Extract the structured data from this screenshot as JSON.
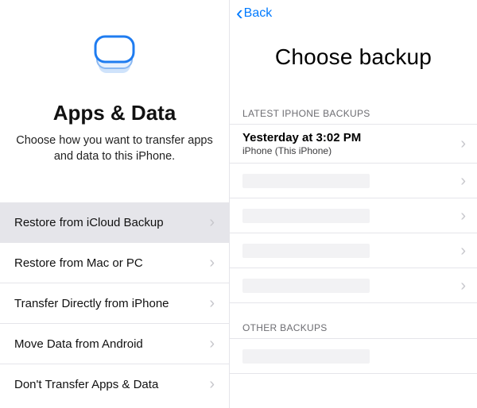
{
  "left": {
    "title": "Apps & Data",
    "subtitle": "Choose how you want to transfer apps and data to this iPhone.",
    "options": [
      {
        "label": "Restore from iCloud Backup",
        "selected": true
      },
      {
        "label": "Restore from Mac or PC",
        "selected": false
      },
      {
        "label": "Transfer Directly from iPhone",
        "selected": false
      },
      {
        "label": "Move Data from Android",
        "selected": false
      },
      {
        "label": "Don't Transfer Apps & Data",
        "selected": false
      }
    ]
  },
  "right": {
    "back_label": "Back",
    "title": "Choose backup",
    "latest_header": "LATEST IPHONE BACKUPS",
    "other_header": "OTHER BACKUPS",
    "latest_backups": [
      {
        "time": "Yesterday at 3:02 PM",
        "device": "iPhone (This iPhone)"
      },
      {
        "placeholder": true
      },
      {
        "placeholder": true
      },
      {
        "placeholder": true
      },
      {
        "placeholder": true
      }
    ],
    "other_backups": [
      {
        "placeholder": true
      }
    ]
  },
  "colors": {
    "accent": "#007aff"
  }
}
